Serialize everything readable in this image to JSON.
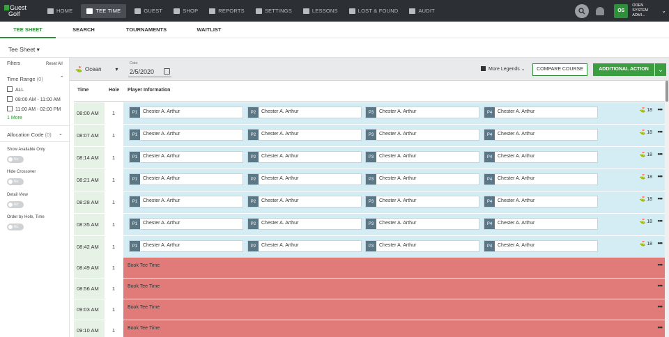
{
  "brand": {
    "line1": "Guest",
    "line2": "Golf"
  },
  "nav": [
    {
      "label": "HOME",
      "icon": "home-icon"
    },
    {
      "label": "TEE TIME",
      "icon": "tee-time-icon",
      "active": true
    },
    {
      "label": "GUEST",
      "icon": "guest-icon"
    },
    {
      "label": "SHOP",
      "icon": "shop-icon"
    },
    {
      "label": "REPORTS",
      "icon": "reports-icon"
    },
    {
      "label": "SETTINGS",
      "icon": "gear-icon"
    },
    {
      "label": "LESSONS",
      "icon": "lessons-icon"
    },
    {
      "label": "LOST & FOUND",
      "icon": "lost-found-icon"
    },
    {
      "label": "AUDIT",
      "icon": "audit-icon"
    }
  ],
  "user": {
    "initials": "OS",
    "name": "ODEN",
    "role": "SYSTEM ADMI..."
  },
  "subtabs": [
    "TEE SHEET",
    "SEARCH",
    "TOURNAMENTS",
    "WAITLIST"
  ],
  "page": {
    "title": "Tee Sheet ▾"
  },
  "filters": {
    "title": "Filters",
    "reset": "Reset All",
    "time_range": "Time Range",
    "time_range_count": "(0)",
    "options": [
      "ALL",
      "08:00 AM - 11:00 AM",
      "11:00 AM - 02:00 PM"
    ],
    "more": "1 More",
    "allocation": "Allocation Code",
    "allocation_count": "(0)",
    "toggles": [
      {
        "label": "Show Available Only",
        "state": "No"
      },
      {
        "label": "Hide Crossover",
        "state": "No"
      },
      {
        "label": "Detail View",
        "state": "No"
      },
      {
        "label": "Order by Hole, Time",
        "state": "No"
      }
    ]
  },
  "toolbar": {
    "course": "Ocean",
    "date_label": "Date",
    "date_value": "2/5/2020",
    "legends": "More Legends",
    "compare": "COMPARE COURSE",
    "action": "ADDITIONAL ACTION"
  },
  "grid": {
    "headers": {
      "time": "Time",
      "hole": "Hole",
      "player": "Player Information"
    },
    "booked": [
      {
        "time": "08:00 AM",
        "hole": "1",
        "players": [
          "Chester A. Arthur",
          "Chester A. Arthur",
          "Chester A. Arthur",
          "Chester A. Arthur"
        ],
        "holes": "18"
      },
      {
        "time": "08:07 AM",
        "hole": "1",
        "players": [
          "Chester A. Arthur",
          "Chester A. Arthur",
          "Chester A. Arthur",
          "Chester A. Arthur"
        ],
        "holes": "18"
      },
      {
        "time": "08:14 AM",
        "hole": "1",
        "players": [
          "Chester A. Arthur",
          "Chester A. Arthur",
          "Chester A. Arthur",
          "Chester A. Arthur"
        ],
        "holes": "18"
      },
      {
        "time": "08:21 AM",
        "hole": "1",
        "players": [
          "Chester A. Arthur",
          "Chester A. Arthur",
          "Chester A. Arthur",
          "Chester A. Arthur"
        ],
        "holes": "18"
      },
      {
        "time": "08:28 AM",
        "hole": "1",
        "players": [
          "Chester A. Arthur",
          "Chester A. Arthur",
          "Chester A. Arthur",
          "Chester A. Arthur"
        ],
        "holes": "18"
      },
      {
        "time": "08:35 AM",
        "hole": "1",
        "players": [
          "Chester A. Arthur",
          "Chester A. Arthur",
          "Chester A. Arthur",
          "Chester A. Arthur"
        ],
        "holes": "18"
      },
      {
        "time": "08:42 AM",
        "hole": "1",
        "players": [
          "Chester A. Arthur",
          "Chester A. Arthur",
          "Chester A. Arthur",
          "Chester A. Arthur"
        ],
        "holes": "18"
      }
    ],
    "open": [
      {
        "time": "08:49 AM",
        "hole": "1",
        "label": "Book Tee Time"
      },
      {
        "time": "08:56 AM",
        "hole": "1",
        "label": "Book Tee Time"
      },
      {
        "time": "09:03 AM",
        "hole": "1",
        "label": "Book Tee Time"
      },
      {
        "time": "09:10 AM",
        "hole": "1",
        "label": "Book Tee Time"
      }
    ],
    "slot_tags": [
      "P1",
      "P2",
      "P3",
      "P4"
    ]
  },
  "colors": {
    "accent": "#2f8f3a",
    "booked": "#d4edf4",
    "open": "#e07b79",
    "time_bg": "#e6f2e6"
  }
}
